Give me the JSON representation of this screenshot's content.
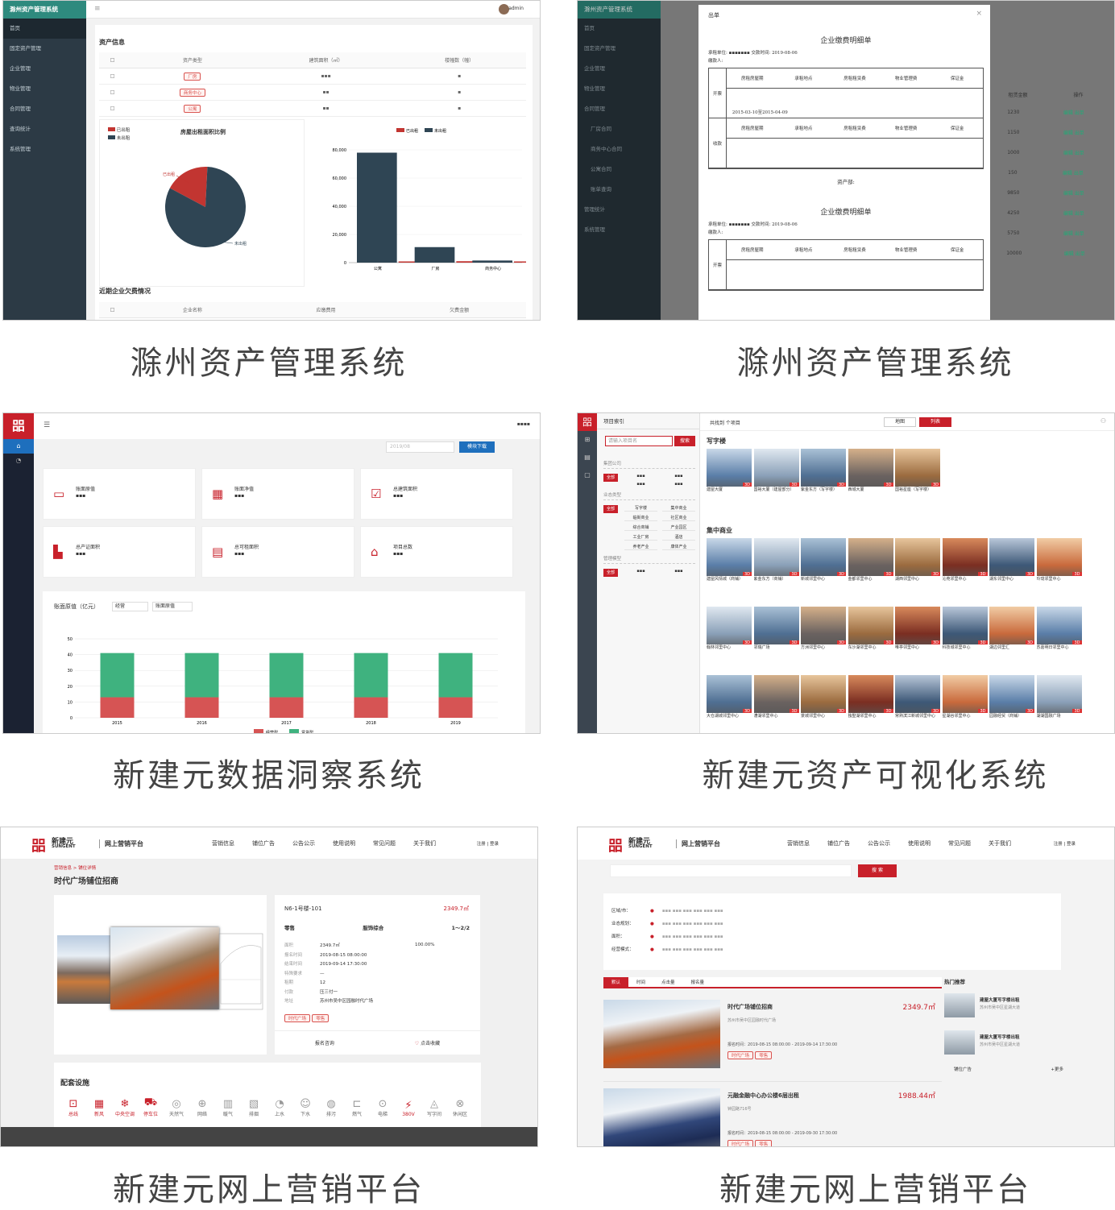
{
  "captions": [
    "滁州资产管理系统",
    "滁州资产管理系统",
    "新建元数据洞察系统",
    "新建元资产可视化系统",
    "新建元网上营销平台",
    "新建元网上营销平台"
  ],
  "s1": {
    "app_title": "滁州资产管理系统",
    "user": "admin",
    "menu": [
      "首页",
      "固定资产管理",
      "企业管理",
      "物业管理",
      "合同管理",
      "查询统计",
      "系统管理"
    ],
    "section_title": "资产信息",
    "table_headers": [
      "资产类型",
      "建筑面积（㎡）",
      "楼幢数（幢）"
    ],
    "rows": [
      {
        "type": "厂房"
      },
      {
        "type": "商务中心"
      },
      {
        "type": "公寓"
      }
    ],
    "pie_title": "房屋出租面积比例",
    "legend": [
      "已出租",
      "未出租"
    ],
    "pie_labels": [
      "已出租",
      "未出租"
    ],
    "pie_data": {
      "rented": 0.18,
      "unrented": 0.82
    },
    "bar_chart": {
      "categories": [
        "公寓",
        "厂房",
        "商务中心"
      ],
      "rented": [
        500,
        1000,
        200
      ],
      "unrented": [
        78000,
        11000,
        1500
      ],
      "yticks": [
        "0",
        "20,000",
        "40,000",
        "60,000",
        "80,000"
      ],
      "ylim": [
        0,
        80000
      ]
    },
    "debt_title": "近期企业欠费情况",
    "debt_headers": [
      "企业名称",
      "应缴费用",
      "欠费金额"
    ]
  },
  "s2": {
    "app_title": "滁州资产管理系统",
    "menu": [
      "首页",
      "固定资产管理",
      "企业管理",
      "物业管理",
      "合同管理",
      "厂房合同",
      "商务中心合同",
      "公寓合同",
      "账单查询",
      "管理统计",
      "系统管理"
    ],
    "modal_title": "出单",
    "doc_title": "企业缴费明细单",
    "unit_label": "承租单位:",
    "date_label": "交款时间:",
    "date": "2019-08-06",
    "payer_label": "缴款人:",
    "cols": [
      "房租房屋期",
      "承租地点",
      "房租租赁费",
      "物业管理费",
      "保证金"
    ],
    "row1": "开票",
    "row2": "收款",
    "period": "2015-03-10至2015-04-09",
    "sign": "资产部:",
    "right_col": [
      "租赁金额",
      "操作"
    ],
    "right_vals": [
      "1230",
      "1150",
      "1000",
      "150",
      "9850",
      "4250",
      "5750",
      "10000"
    ],
    "ops": [
      "编辑",
      "出单"
    ]
  },
  "s3": {
    "legend": [
      "经营型",
      "赁货型"
    ],
    "button": "模块下载",
    "date_input": "2019/08",
    "cards": [
      "账面原值",
      "账面净值",
      "总建筑面积",
      "总产证面积",
      "总可租面积",
      "项目总数"
    ],
    "chart_title": "账面原值（亿元）",
    "select1": "经营",
    "select2": "账面原值",
    "chart_data": {
      "type": "bar",
      "categories": [
        "2015",
        "2016",
        "2017",
        "2018",
        "2019"
      ],
      "series": [
        {
          "name": "经营型",
          "values": [
            13,
            13,
            13,
            13,
            13
          ]
        },
        {
          "name": "赁货型",
          "values": [
            28,
            28,
            28,
            28,
            28
          ]
        }
      ],
      "ylim": [
        0,
        50
      ],
      "yticks": [
        "0",
        "10",
        "20",
        "30",
        "40",
        "50"
      ]
    }
  },
  "s4": {
    "panel_title": "项目索引",
    "search_placeholder": "请输入项目名",
    "search_button": "搜索",
    "header_text": "共找到 个项目",
    "view_map": "地图",
    "view_list": "列表",
    "filter_groups": [
      {
        "label": "集团公司",
        "items": [
          "全部"
        ]
      },
      {
        "label": "业态类型",
        "items": [
          "写字楼",
          "集中商业",
          "临街商业",
          "社区商业",
          "综合商铺",
          "产业园区",
          "工业厂房",
          "酒店",
          "养老产业",
          "康体产业"
        ]
      },
      {
        "label": "管理模型",
        "items": [
          "全部"
        ]
      }
    ],
    "sections": [
      "写字楼",
      "集中商业"
    ],
    "office": [
      "建屋大厦",
      "国裕大厦（建屋部分）",
      "紫金东方（写字楼）",
      "西城大厦",
      "国裕星座（写字楼）"
    ],
    "mall": [
      "建屋风情城（商铺）",
      "紫金东方（商铺）",
      "新城邻里中心",
      "金都邻里中心",
      "湖西邻里中心",
      "沁苑邻里中心",
      "湖东邻里中心",
      "玲珑邻里中心",
      "翰林邻里中心",
      "邻瑞广场",
      "方洲邻里中心",
      "东沙湖邻里中心",
      "唯亭邻里中心",
      "科技城邻里中心",
      "湖边邻里汇",
      "苏嘉明日邻里中心",
      "大仓湖城邻里中心",
      "漕湖邻里中心",
      "景城邻里中心",
      "独墅湖邻里中心",
      "常熟滨江新城邻里中心",
      "星湖谷邻里中心",
      "园融经贸（商铺）",
      "湖湖国融广场"
    ]
  },
  "s5": {
    "brand": "新建元",
    "brand_en": "SUNGENT",
    "platform": "网上营销平台",
    "nav": [
      "营销信息",
      "铺位广告",
      "公告公示",
      "使用说明",
      "常见问题",
      "关于我们"
    ],
    "auth": "注册 | 登录",
    "breadcrumb": "营销信息 > 铺位详情",
    "title": "时代广场铺位招商",
    "unit": "N6-1号楼-101",
    "area": "2349.7㎡",
    "kv": [
      "零售",
      "服饰综合",
      "1～2/2"
    ],
    "fields": [
      {
        "k": "面积",
        "v": "2349.7㎡"
      },
      {
        "k": "报名时间",
        "v": "2019-08-15 08:00:00"
      },
      {
        "k": "结束时间",
        "v": "2019-09-14 17:30:00"
      },
      {
        "k": "特殊要求",
        "v": "—"
      },
      {
        "k": "租期",
        "v": "12"
      },
      {
        "k": "付款",
        "v": "压三付一"
      },
      {
        "k": "地址",
        "v": "苏州市吴中区园融时代广场"
      }
    ],
    "rate": "100.00%",
    "tags": [
      "时代广场",
      "零售"
    ],
    "act1": "报名咨询",
    "act2": "点击收藏",
    "facilities_title": "配套设施",
    "facilities": [
      "总线",
      "新风",
      "中央空调",
      "停车位",
      "天然气",
      "网络",
      "暖气",
      "排烟",
      "上水",
      "下水",
      "排污",
      "燃气",
      "电梯",
      "380V",
      "写字间",
      "休闲区"
    ]
  },
  "s6": {
    "brand": "新建元",
    "brand_en": "SUNGENT",
    "platform": "网上营销平台",
    "nav": [
      "营销信息",
      "铺位广告",
      "公告公示",
      "使用说明",
      "常见问题",
      "关于我们"
    ],
    "auth": "注册 | 登录",
    "search_btn": "搜 索",
    "filter_labels": [
      "区域/市：",
      "业态规划：",
      "面积：",
      "经营模式："
    ],
    "sort": [
      "默认",
      "时间",
      "点击量",
      "报名量"
    ],
    "listings": [
      {
        "title": "时代广场铺位招商",
        "area": "2349.7㎡",
        "addr": "苏州市吴中区园融时代广场",
        "time": "报名时间：2019-08-15 08:00:00 - 2019-09-14 17:30:00"
      },
      {
        "title": "元融金融中心办公楼6层出租",
        "area": "1988.44㎡",
        "addr": "钟园路716号",
        "time": "报名时间：2019-08-15 08:00:00 - 2019-09-30 17:30:00"
      }
    ],
    "hot_title": "热门推荐",
    "hot": [
      {
        "t": "建屋大厦写字楼出租",
        "s": "苏州市吴中区星湖大道"
      },
      {
        "t": "建屋大厦写字楼出租",
        "s": "苏州市吴中区星湖大道"
      }
    ],
    "ad": "铺位广告",
    "more": "+更多"
  }
}
